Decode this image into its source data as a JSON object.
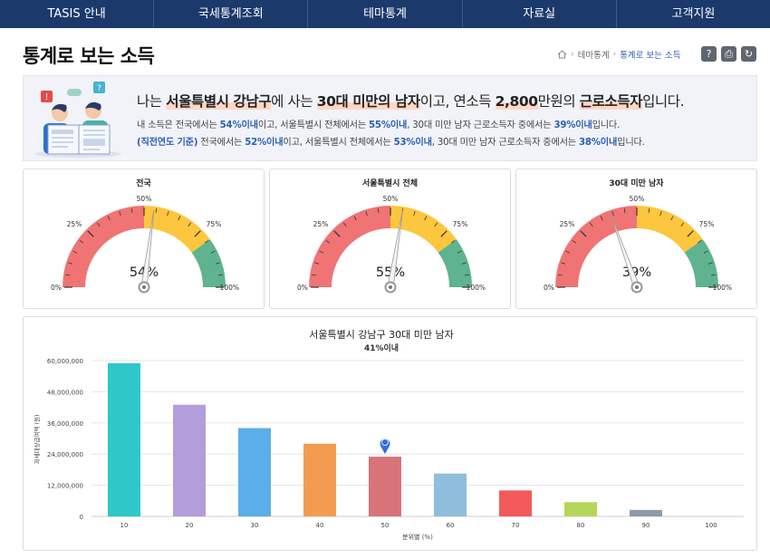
{
  "nav": [
    "TASIS 안내",
    "국세통계조회",
    "테마통계",
    "자료실",
    "고객지원"
  ],
  "page_title": "통계로 보는 소득",
  "breadcrumb": {
    "level1": "테마통계",
    "current": "통계로 보는 소득"
  },
  "toolbar": {
    "help": "?",
    "print": "⎙",
    "refresh": "↻"
  },
  "summary": {
    "h_prefix": "나는 ",
    "h_region": "서울특별시 강남구",
    "h_mid1": "에 사는 ",
    "h_group": "30대 미만의 남자",
    "h_mid2": "이고, 연소득 ",
    "h_income": "2,800",
    "h_mid3": "만원의 ",
    "h_type": "근로소득자",
    "h_suffix": "입니다.",
    "l1_a": "내 소득은 전국에서는 ",
    "l1_v1": "54%이내",
    "l1_b": "이고, 서울특별시 전체에서는 ",
    "l1_v2": "55%이내",
    "l1_c": ", 30대 미만 남자 근로소득자 중에서는 ",
    "l1_v3": "39%이내",
    "l1_d": "입니다.",
    "l2_tag": "(직전연도 기준)",
    "l2_a": " 전국에서는 ",
    "l2_v1": "52%이내",
    "l2_b": "이고, 서울특별시 전체에서는 ",
    "l2_v2": "53%이내",
    "l2_c": ", 30대 미만 남자 근로소득자 중에서는 ",
    "l2_v3": "38%이내",
    "l2_d": "입니다."
  },
  "gauges": [
    {
      "title": "전국",
      "value": 54,
      "value_label": "54%"
    },
    {
      "title": "서울특별시 전체",
      "value": 55,
      "value_label": "55%"
    },
    {
      "title": "30대 미만 남자",
      "value": 39,
      "value_label": "39%"
    }
  ],
  "gauge_ticks": {
    "t0": "0%",
    "t25": "25%",
    "t50": "50%",
    "t75": "75%",
    "t100": "100%"
  },
  "gauge_colors": {
    "red": "#f07474",
    "yellow": "#fcc63e",
    "green": "#5fb38e"
  },
  "chart_data": {
    "type": "bar",
    "title": "서울특별시 강남구 30대 미만 남자",
    "subtitle": "41%이내",
    "xlabel": "분위별 (%)",
    "ylabel": "과세대상급여액 (원)",
    "categories": [
      "10",
      "20",
      "30",
      "40",
      "50",
      "60",
      "70",
      "80",
      "90",
      "100"
    ],
    "values": [
      59000000,
      43000000,
      34000000,
      28000000,
      23000000,
      16500000,
      10000000,
      5500000,
      2500000,
      0
    ],
    "colors": [
      "#2ec8c8",
      "#b39ddb",
      "#5aafe8",
      "#f39c4f",
      "#d9737a",
      "#8fbedd",
      "#f25a5a",
      "#b5d65a",
      "#8e9aab",
      "#cccccc"
    ],
    "ylim": [
      0,
      60000000
    ],
    "yticks": [
      "0",
      "12,000,000",
      "24,000,000",
      "36,000,000",
      "48,000,000",
      "60,000,000"
    ],
    "marker_category": "50",
    "grid": true
  }
}
